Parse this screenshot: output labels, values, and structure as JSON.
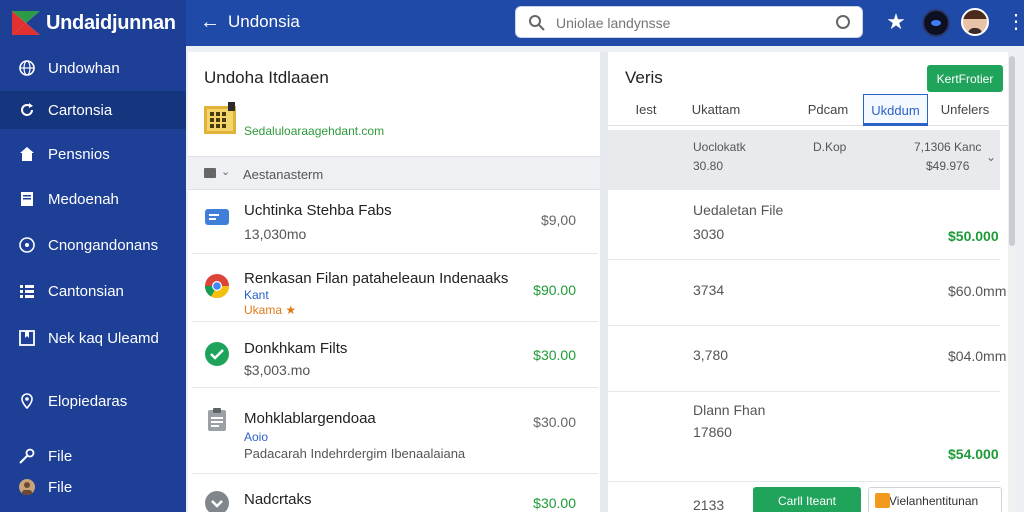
{
  "app": {
    "title": "Undaidjunnan",
    "page_title": "Undonsia"
  },
  "search": {
    "placeholder": "Uniolae landynsse"
  },
  "sidebar": {
    "items": [
      {
        "label": "Undowhan",
        "icon": "globe-icon"
      },
      {
        "label": "Cartonsia",
        "icon": "refresh-icon"
      },
      {
        "label": "Pensnios",
        "icon": "home-icon"
      },
      {
        "label": "Medoenah",
        "icon": "document-icon"
      },
      {
        "label": "Cnongandonans",
        "icon": "circle-icon"
      },
      {
        "label": "Cantonsian",
        "icon": "list-icon"
      },
      {
        "label": "Nek kaq Uleamd",
        "icon": "bookmark-icon"
      },
      {
        "label": "Elopiedaras",
        "icon": "location-icon"
      },
      {
        "label": "File",
        "icon": "key-icon"
      },
      {
        "label": "File",
        "icon": "avatar-icon"
      }
    ]
  },
  "left_panel": {
    "title": "Undoha Itdlaaen",
    "url": "Sedaluloaraagehdant.com",
    "section_label": "Aestanasterm",
    "rows": [
      {
        "title": "Uchtinka Stehba Fabs",
        "sub": "13,030mo",
        "amount": "$9,00",
        "icon": "card-icon"
      },
      {
        "title": "Renkasan Filan pataheleaun Indenaaks",
        "sub": "Kant",
        "sub2": "Ukama ★",
        "amount": "$90.00",
        "icon": "chrome-icon"
      },
      {
        "title": "Donkhkam Filts",
        "sub": "$3,003.mo",
        "amount": "$30.00",
        "icon": "check-icon"
      },
      {
        "title": "Mohklablargendoaa",
        "sub": "Aoio",
        "sub2": "Padacarah Indehrdergim Ibenaalaiana",
        "amount": "$30.00",
        "icon": "clipboard-icon"
      },
      {
        "title": "Nadcrtaks",
        "amount": "$30.00",
        "icon": "down-icon"
      }
    ]
  },
  "right_panel": {
    "title": "Veris",
    "top_button": "KertFrotier",
    "tabs": [
      "Iest",
      "Ukattam",
      "Pdcam",
      "Ukddum",
      "Unfelers"
    ],
    "active_tab": 3,
    "header": {
      "col1_line1": "Uoclokatk",
      "col1_line2": "30.80",
      "col2": "D.Kop",
      "col3_line1": "7,1306 Kanc",
      "col3_line2": "$49.976"
    },
    "rows": [
      {
        "label": "Uedaletan File",
        "value": "3030",
        "amount": "$50.000"
      },
      {
        "value": "3734",
        "amount": "$60.0mm"
      },
      {
        "value": "3,780",
        "amount": "$04.0mm"
      },
      {
        "label": "Dlann Fhan",
        "value": "17860",
        "amount": "$54.000"
      },
      {
        "value": "2133"
      }
    ],
    "bottom_button_green": "Carll Iteant",
    "bottom_button_white": "Vielanhentitunan"
  },
  "colors": {
    "topbar": "#1f4aa8",
    "sidebar": "#1d3f96",
    "accent_green": "#20a35a",
    "price_green": "#1e9a38",
    "link_blue": "#2b62c8"
  }
}
